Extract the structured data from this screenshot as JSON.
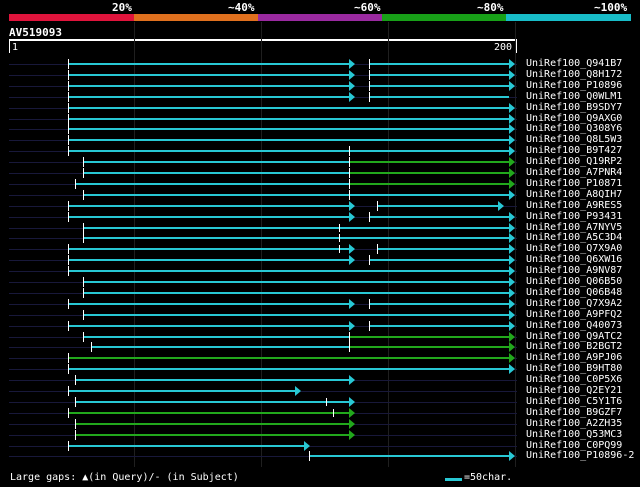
{
  "header": {
    "percent_labels": [
      "20%",
      "~40%",
      "~60%",
      "~80%",
      "~100%"
    ],
    "identity_bands": [
      {
        "name": "20%",
        "color": "#e0143c"
      },
      {
        "name": "~40%",
        "color": "#e0701e"
      },
      {
        "name": "~60%",
        "color": "#9a2aa0"
      },
      {
        "name": "~80%",
        "color": "#18a018"
      },
      {
        "name": "~100%",
        "color": "#18bcc8"
      }
    ],
    "query_id": "AV519093",
    "ruler_start": "1",
    "ruler_end": "200"
  },
  "colors": {
    "cyan": "#28c8d4",
    "green": "#22a81c",
    "row_bg": "#18183a",
    "text": "#ffffff",
    "background": "#000000"
  },
  "hits": [
    {
      "label": "UniRef100_Q941B7"
    },
    {
      "label": "UniRef100_Q8H172"
    },
    {
      "label": "UniRef100_P10896"
    },
    {
      "label": "UniRef100_Q0WLM1"
    },
    {
      "label": "UniRef100_B9SDY7"
    },
    {
      "label": "UniRef100_Q9AXG0"
    },
    {
      "label": "UniRef100_Q308Y6"
    },
    {
      "label": "UniRef100_Q8L5W3"
    },
    {
      "label": "UniRef100_B9T427"
    },
    {
      "label": "UniRef100_Q19RP2"
    },
    {
      "label": "UniRef100_A7PNR4"
    },
    {
      "label": "UniRef100_P10871"
    },
    {
      "label": "UniRef100_A8QIH7"
    },
    {
      "label": "UniRef100_A9RES5"
    },
    {
      "label": "UniRef100_P93431"
    },
    {
      "label": "UniRef100_A7NYV5"
    },
    {
      "label": "UniRef100_A5C3D4"
    },
    {
      "label": "UniRef100_Q7X9A0"
    },
    {
      "label": "UniRef100_Q6XW16"
    },
    {
      "label": "UniRef100_A9NV87"
    },
    {
      "label": "UniRef100_Q06B50"
    },
    {
      "label": "UniRef100_Q06B48"
    },
    {
      "label": "UniRef100_Q7X9A2"
    },
    {
      "label": "UniRef100_A9PFQ2"
    },
    {
      "label": "UniRef100_Q40073"
    },
    {
      "label": "UniRef100_Q9ATC2"
    },
    {
      "label": "UniRef100_B2BGT2"
    },
    {
      "label": "UniRef100_A9PJ06"
    },
    {
      "label": "UniRef100_B9HT80"
    },
    {
      "label": "UniRef100_C0P5X6"
    },
    {
      "label": "UniRef100_Q2EY21"
    },
    {
      "label": "UniRef100_C5Y1T6"
    },
    {
      "label": "UniRef100_B9GZF7"
    },
    {
      "label": "UniRef100_A2ZH35"
    },
    {
      "label": "UniRef100_Q53MC3"
    },
    {
      "label": "UniRef100_C0PQ99"
    },
    {
      "label": "UniRef100_P10896-2"
    }
  ],
  "legend": {
    "gaps_text": "Large gaps: ▲(in Query)/- (in Subject)",
    "scale_text": "=50char."
  }
}
